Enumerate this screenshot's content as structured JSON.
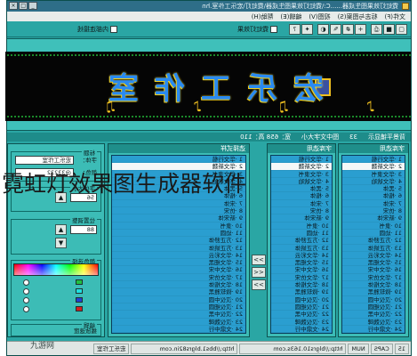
{
  "window": {
    "title": "霓虹灯效果图生成器......C:\\霓虹灯效果图生成器\\霓虹灯\\宏乐工作室.hn",
    "min": "_",
    "max": "□",
    "close": "×"
  },
  "menu": [
    "文件(F)",
    "标志与图案(S)",
    "视图(V)",
    "编辑(E)",
    "帮助(H)"
  ],
  "toolbar": {
    "check1": "霓虹灯效果",
    "check2": "内部连接线"
  },
  "preview": {
    "text": "宏乐工作室",
    "notes": "♪ ♫ ♪ ♫"
  },
  "infobar": {
    "left": "背景平铺显示",
    "mid": "33",
    "mid2": "图中文字大小",
    "right": "宽：658  高：110"
  },
  "panels": {
    "left": {
      "header": "字库选用",
      "rows": [
        "1 ·华文行楷",
        "2 ·华文新魏",
        "3 ·华文隶书",
        "4 ·华文琥珀",
        "5 ·黑体",
        "6 ·楷体",
        "7 ·宋体",
        "8 ·仿宋",
        "9 ·新宋体",
        "10 ·隶书",
        "11 ·幼圆",
        "12 ·方正舒体",
        "13 ·方正姚体",
        "14 ·华文彩云",
        "15 ·华文细黑",
        "16 ·华文中宋",
        "17 ·华文仿宋",
        "18 ·华文楷体",
        "19 ·微软雅黑",
        "20 ·汉仪中圆",
        "21 ·汉仪细圆",
        "22 ·汉仪中黑",
        "23 ·汉仪魏碑",
        "24 ·文鼎中行",
        "25 ·文鼎粗行"
      ]
    },
    "mid": {
      "header": "字库选用",
      "rows": [
        "1 ·华文行楷",
        "2 ·华文新魏",
        "3 ·华文隶书",
        "4 ·华文琥珀",
        "5 ·黑体",
        "6 ·楷体",
        "7 ·宋体",
        "8 ·仿宋",
        "9 ·新宋体",
        "10 ·隶书",
        "11 ·幼圆",
        "12 ·方正舒体",
        "13 ·方正姚体",
        "14 ·华文彩云",
        "15 ·华文细黑",
        "16 ·华文中宋",
        "17 ·华文仿宋",
        "18 ·华文楷体",
        "19 ·微软雅黑",
        "20 ·汉仪中圆",
        "21 ·汉仪细圆",
        "22 ·汉仪中黑",
        "23 ·汉仪魏碑",
        "24 ·文鼎中行",
        "25 ·文鼎粗行"
      ]
    },
    "list3": {
      "header": "选择式样",
      "rows": [
        "1 ·华文行楷",
        "2 ·华文新魏",
        "3 ·华文隶书",
        "4 ·华文琥珀",
        "5 ·黑体",
        "6 ·楷体",
        "7 ·宋体",
        "8 ·仿宋",
        "9 ·新宋体",
        "10 ·隶书",
        "11 ·幼圆",
        "12 ·方正舒体",
        "13 ·方正姚体",
        "14 ·华文彩云",
        "15 ·华文细黑",
        "16 ·华文中宋",
        "17 ·华文仿宋",
        "18 ·华文楷体",
        "19 ·微软雅黑",
        "20 ·汉仪中圆",
        "21 ·汉仪细圆",
        "22 ·汉仪中黑",
        "23 ·汉仪魏碑",
        "24 ·文鼎中行",
        "25 ·文鼎粗行"
      ]
    }
  },
  "midbtns": [
    ">>",
    "<<",
    ">>"
  ],
  "right": {
    "group1": "标题",
    "label1": "字体：",
    "value1": "宏乐工作室",
    "label2": "颜色：",
    "value2": "@33232",
    "group2": "字体大小",
    "size_value": "56",
    "group3": "位置调整",
    "pos_value": "88",
    "group4": "颜色选择",
    "colors": [
      "#20c040",
      "#20e0e0",
      "#2040d0",
      "#d02020"
    ],
    "group5": "编辑",
    "slider_label": "播放速度"
  },
  "status": [
    "15",
    "CAPS",
    "NUM",
    "http://blgrs10.163s.com",
    "http://bbs1.blgrs82in.com",
    "宏乐工作室"
  ],
  "caption": "霓虹灯效果图生成器软件",
  "watermark": "九游网"
}
